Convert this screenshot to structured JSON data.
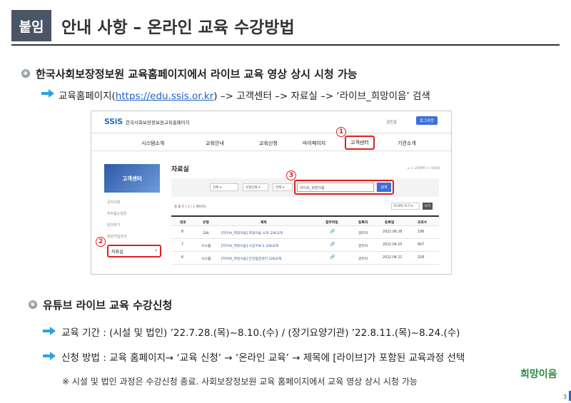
{
  "header": {
    "tag": "붙임",
    "title": "안내 사항 – 온라인 교육 수강방법"
  },
  "section1": {
    "heading": "한국사회보장정보원 교육홈페이지에서 라이브 교육 영상 상시 시청 가능",
    "path_prefix": "교육홈페이지(",
    "path_link": "https://edu.ssis.or.kr",
    "path_suffix": ") –> 고객센터 –> 자료실 –> ‘라이브_희망이음’ 검색"
  },
  "screenshot": {
    "logo": "SSiS",
    "site_name": "한국사회보장정보원교육홈페이지",
    "user": "김민준",
    "login": "로그아웃",
    "nav": [
      "시스템소개",
      "교육안내",
      "교육신청",
      "마이페이지",
      "고객센터",
      "기관소개"
    ],
    "side_title": "고객센터",
    "side_items": [
      "공지사항",
      "자주묻는질문",
      "문의하기",
      "회원가입안내"
    ],
    "side_active": "자료실",
    "page_title": "자료실",
    "breadcrumb": "⌂ > 고객센터 > 자료실",
    "filters": [
      "전체",
      "유형선택",
      "전체"
    ],
    "search_value": "라이브_희망이음",
    "search_button": "검색",
    "count_prefix": "총",
    "count_value": "3",
    "count_suffix": "건 ( 1 / 1 페이지)",
    "per_page": "10개씩 보기",
    "view_button": "보기",
    "table_headers": [
      "번호",
      "유형",
      "제목",
      "첨부파일",
      "등록자",
      "등록일",
      "조회수"
    ],
    "rows": [
      {
        "no": "8",
        "type": "교육",
        "title": "[라이브_희망이음] 희망이음 소개 교육교재",
        "author": "관리자",
        "date": "2022.06.28",
        "views": "198"
      },
      {
        "no": "7",
        "type": "시스템",
        "title": "[라이브_희망이음] 시군구보고 교육교재",
        "author": "관리자",
        "date": "2022.04.25",
        "views": "667"
      },
      {
        "no": "6",
        "type": "시스템",
        "title": "[라이브_희망이음] 안전점검관리 교육교재",
        "author": "관리자",
        "date": "2022.04.21",
        "views": "328"
      }
    ],
    "markers": [
      "1",
      "2",
      "3"
    ]
  },
  "section2": {
    "heading": "유튜브 라이브 교육 수강신청",
    "period": "교육 기간 : (시설 및 법인) ’22.7.28.(목)~8.10.(수)  /  (장기요양기관) ’22.8.11.(목)~8.24.(수)",
    "method": "신청 방법 : 교육 홈페이지→ ‘교육 신청’ → ‘온라인 교육’ → 제목에 [라이브]가 포함된 교육과정 선택"
  },
  "note": "※ 시설 및 법인 과정은 수강신청 종료. 사회보장정보원 교육 홈페이지에서 교육 영상 상시 시청 가능",
  "footer": {
    "logo": "희망이음",
    "page_number": "3"
  },
  "colors": {
    "accent_red": "#e02020",
    "arrow_blue": "#2aa3e0",
    "link_blue": "#1f5fc2",
    "header_tag": "#4a5566"
  }
}
